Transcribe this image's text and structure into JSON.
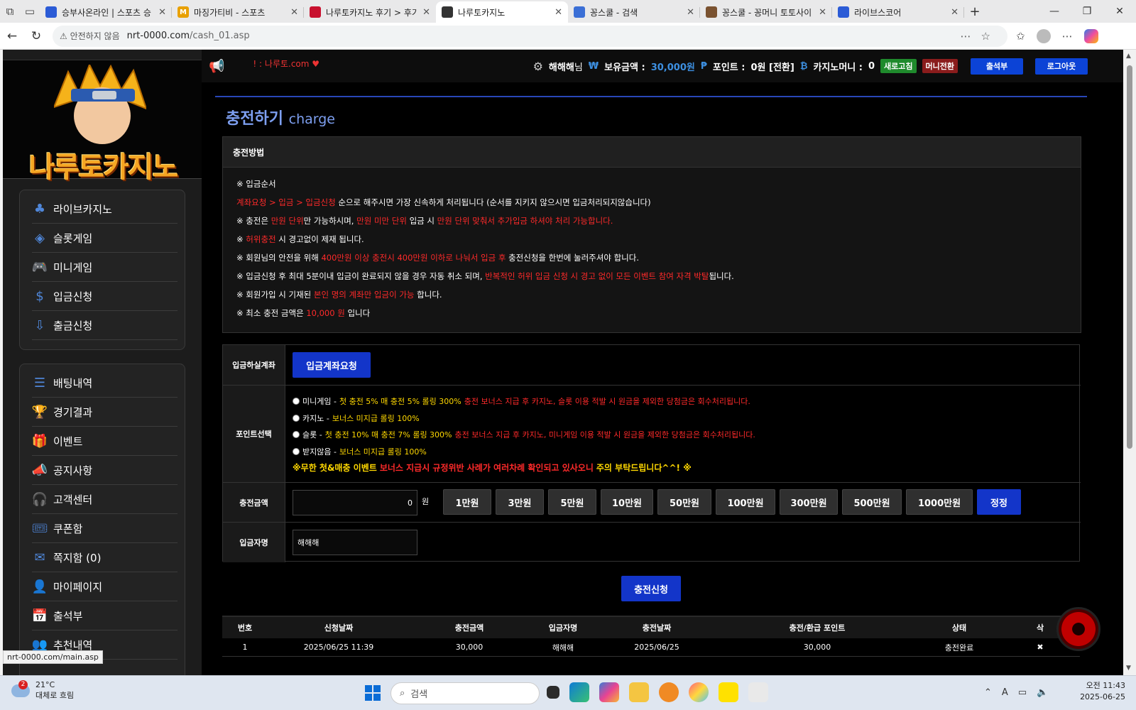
{
  "browser": {
    "tabs": [
      {
        "title": "승부사온라인 | 스포츠 승",
        "fav_color": "#2b5bd6",
        "fav_text": ""
      },
      {
        "title": "마징가티비 - 스포츠",
        "fav_color": "#e8a000",
        "fav_text": "M"
      },
      {
        "title": "나루토카지노 후기 > 후기",
        "fav_color": "#c8102e",
        "fav_text": ""
      },
      {
        "title": "나루토카지노",
        "fav_color": "#333333",
        "fav_text": ""
      },
      {
        "title": "꽁스쿨 - 검색",
        "fav_color": "#3b6fd6",
        "fav_text": ""
      },
      {
        "title": "꽁스쿨 - 꽁머니 토토사이",
        "fav_color": "#7a5230",
        "fav_text": ""
      },
      {
        "title": "라이브스코어",
        "fav_color": "#2b5bd6",
        "fav_text": ""
      }
    ],
    "url_warning": "안전하지 않음",
    "url_host": "nrt-0000.com",
    "url_path": "/cash_01.asp"
  },
  "site": {
    "logo_text": "나루토카지노",
    "marquee": "! : 나루토.com ♥",
    "user": {
      "name": "해해해",
      "suffix": "님",
      "balance_label": "보유금액 :",
      "balance_value": "30,000원",
      "point_label": "포인트 :",
      "point_value": "0원 [전환]",
      "casino_label": "카지노머니 :",
      "casino_value": "0"
    },
    "buttons": {
      "refresh": "새로고침",
      "convert": "머니전환",
      "attendance": "출석부",
      "logout": "로그아웃"
    },
    "menu1": [
      "라이브카지노",
      "슬롯게임",
      "미니게임",
      "입금신청",
      "출금신청"
    ],
    "menu2": [
      "배팅내역",
      "경기결과",
      "이벤트",
      "공지사항",
      "고객센터",
      "쿠폰함",
      "쪽지함 (0)",
      "마이페이지",
      "출석부",
      "추천내역"
    ]
  },
  "charge": {
    "title": "충전하기",
    "subtitle": "charge",
    "method_title": "충전방법",
    "lines": {
      "l1": "※ 입금순서",
      "l2a": "계좌요청 > 입금 > 입금신청",
      "l2b": " 순으로 해주시면 가장 신속하게 처리됩니다 (순서를 지키지 않으시면 입금처리되지않습니다)",
      "l3a": "※ 충전은 ",
      "l3b": "만원 단위",
      "l3c": "만 가능하시며, ",
      "l3d": "만원 미만 단위",
      "l3e": " 입금 시 ",
      "l3f": "만원 단위 맞춰서 추가입금 하셔야 처리 가능합니다.",
      "l4a": "※ ",
      "l4b": "허위충전",
      "l4c": " 시 경고없이 제재 됩니다.",
      "l5a": "※ 회원님의 안전을 위해 ",
      "l5b": "400만원 이상 충전시 400만원 이하로 나눠서 입금 후",
      "l5c": " 충전신청을 한번에 눌러주셔야 합니다.",
      "l6a": "※ 입금신청 후 최대 5분이내 입금이 완료되지 않을 경우 자동 취소 되며, ",
      "l6b": "반복적인 허위 입금 신청 시 경고 없이 모든 이벤트 참여 자격 박탈",
      "l6c": "됩니다.",
      "l7a": "※ 회원가입 시 기재된 ",
      "l7b": "본인 명의 계좌만 입금이 가능",
      "l7c": " 합니다.",
      "l8a": "※ 최소 충전 금액은 ",
      "l8b": "10,000 원",
      "l8c": " 입니다"
    },
    "form": {
      "account_label": "입금하실계좌",
      "account_btn": "입금계좌요청",
      "point_label": "포인트선택",
      "opt1a": "미니게임 - ",
      "opt1b": "첫 충전 5% 매 충전 5% 롤링 300%",
      "opt1c": " 충전 보너스 지급 후 카지노, 슬롯 이용 적발 시 원금을 제외한 당첨금은 회수처리됩니다.",
      "opt2a": "카지노 - ",
      "opt2b": "보너스 미지급 롤링 100%",
      "opt3a": "슬롯 - ",
      "opt3b": "첫 충전 10% 매 충전 7% 롤링 300%",
      "opt3c": " 충전 보너스 지급 후 카지노, 미니게임 이용 적발 시 원금을 제외한 당첨금은 회수처리됩니다.",
      "opt4a": "받지않음 - ",
      "opt4b": "보너스 미지급 롤링 100%",
      "notice_a": "※무한 첫&매충 이벤트 ",
      "notice_b": "보너스 지급시 규정위반 사례가 여러차례 확인되고 있사오니",
      "notice_c": " 주의 부탁드립니다^^! ※",
      "amount_label": "충전금액",
      "amount_value": "0",
      "won": "원",
      "amount_buttons": [
        "1만원",
        "3만원",
        "5만원",
        "10만원",
        "50만원",
        "100만원",
        "300만원",
        "500만원",
        "1000만원"
      ],
      "reset": "정정",
      "name_label": "입금자명",
      "name_value": "해해해",
      "submit": "충전신청"
    },
    "history": {
      "headers": [
        "번호",
        "신청날짜",
        "충전금액",
        "입금자명",
        "충전날짜",
        "충전/환급 포인트",
        "상태",
        "삭"
      ],
      "rows": [
        [
          "1",
          "2025/06/25 11:39",
          "30,000",
          "해해해",
          "2025/06/25",
          "30,000",
          "충전완료",
          "✖"
        ]
      ]
    }
  },
  "status_url": "nrt-0000.com/main.asp",
  "taskbar": {
    "temp": "21°C",
    "weather": "대체로 흐림",
    "badge": "2",
    "search": "검색",
    "time": "오전 11:43",
    "date": "2025-06-25"
  }
}
